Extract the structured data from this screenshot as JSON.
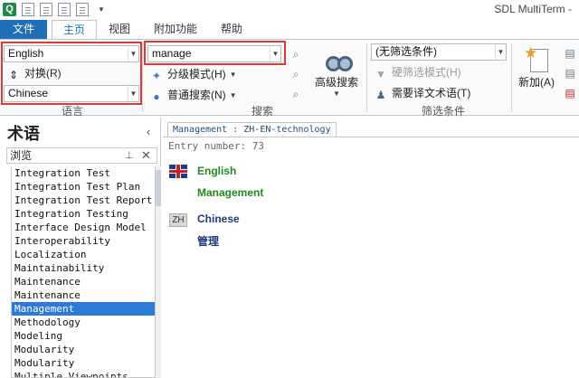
{
  "window": {
    "title": "SDL MultiTerm -"
  },
  "ribbon_tabs": {
    "file": "文件",
    "home": "主页",
    "view": "视图",
    "addins": "附加功能",
    "help": "帮助"
  },
  "language_group": {
    "source_language": "English",
    "swap_label": "对换(R)",
    "target_language": "Chinese",
    "group_label": "语言"
  },
  "search_group": {
    "query": "manage",
    "fuzzy_label": "分级模式(H)",
    "normal_search_label": "普通搜索(N)",
    "advanced_search_label": "高级搜索",
    "group_label": "搜索"
  },
  "filter_group": {
    "filter_value": "(无筛选条件)",
    "hard_filter_label": "硬筛选模式(H)",
    "need_translate_label": "需要译文术语(T)",
    "group_label": "筛选条件"
  },
  "add_group": {
    "add_label": "新加(A)"
  },
  "left_panel": {
    "title": "术语",
    "browse_label": "浏览",
    "terms": [
      "Integration Test",
      "Integration Test Plan",
      "Integration Test Report",
      "Integration Testing",
      "Interface Design Model",
      "Interoperability",
      "Localization",
      "Maintainability",
      "Maintenance",
      "Maintenance",
      "Management",
      "Methodology",
      "Modeling",
      "Modularity",
      "Modularity",
      "Multiple Viewpoints"
    ],
    "selected_term": "Management"
  },
  "entry": {
    "tab_label": "Management : ZH-EN-technology",
    "entry_number": "Entry number: 73",
    "source_language": "English",
    "source_term": "Management",
    "target_badge": "ZH",
    "target_language": "Chinese",
    "target_term": "管理"
  },
  "colors": {
    "accent": "#1e6fb7",
    "highlight_box": "#d93b3b",
    "selected_row": "#2b7bd6",
    "english_term": "#1f8a1f",
    "chinese_term": "#1e3a7a"
  }
}
